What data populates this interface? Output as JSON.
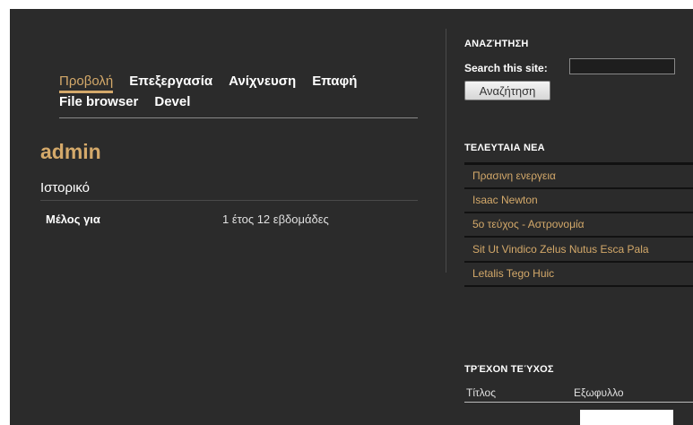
{
  "tabs": {
    "row1": [
      "Προβολή",
      "Επεξεργασία",
      "Ανίχνευση",
      "Επαφή"
    ],
    "row2": [
      "File browser",
      "Devel"
    ],
    "active": "Προβολή"
  },
  "main": {
    "title": "admin",
    "section": "Ιστορικό",
    "member_label": "Μέλος για",
    "member_value": "1 έτος 12 εβδομάδες"
  },
  "sidebar": {
    "search": {
      "title": "ΑΝΑΖΉΤΗΣΗ",
      "label": "Search this site:",
      "input_value": "",
      "button": "Αναζήτηση"
    },
    "news": {
      "title": "ΤΕΛΕΥΤΑΙΑ ΝΕΑ",
      "items": [
        "Πρασινη ενεργεια",
        "Isaac Newton",
        "5ο τεύχος - Αστρονομία",
        "Sit Ut Vindico Zelus Nutus Esca Pala",
        "Letalis Tego Huic"
      ]
    },
    "issue": {
      "title": "ΤΡΈΧΟΝ ΤΕΎΧΟΣ",
      "col_title": "Τίτλος",
      "col_cover": "Εξωφυλλο"
    }
  },
  "colors": {
    "background": "#2b2b2b",
    "accent": "#d4a96a",
    "text": "#ffffff"
  }
}
